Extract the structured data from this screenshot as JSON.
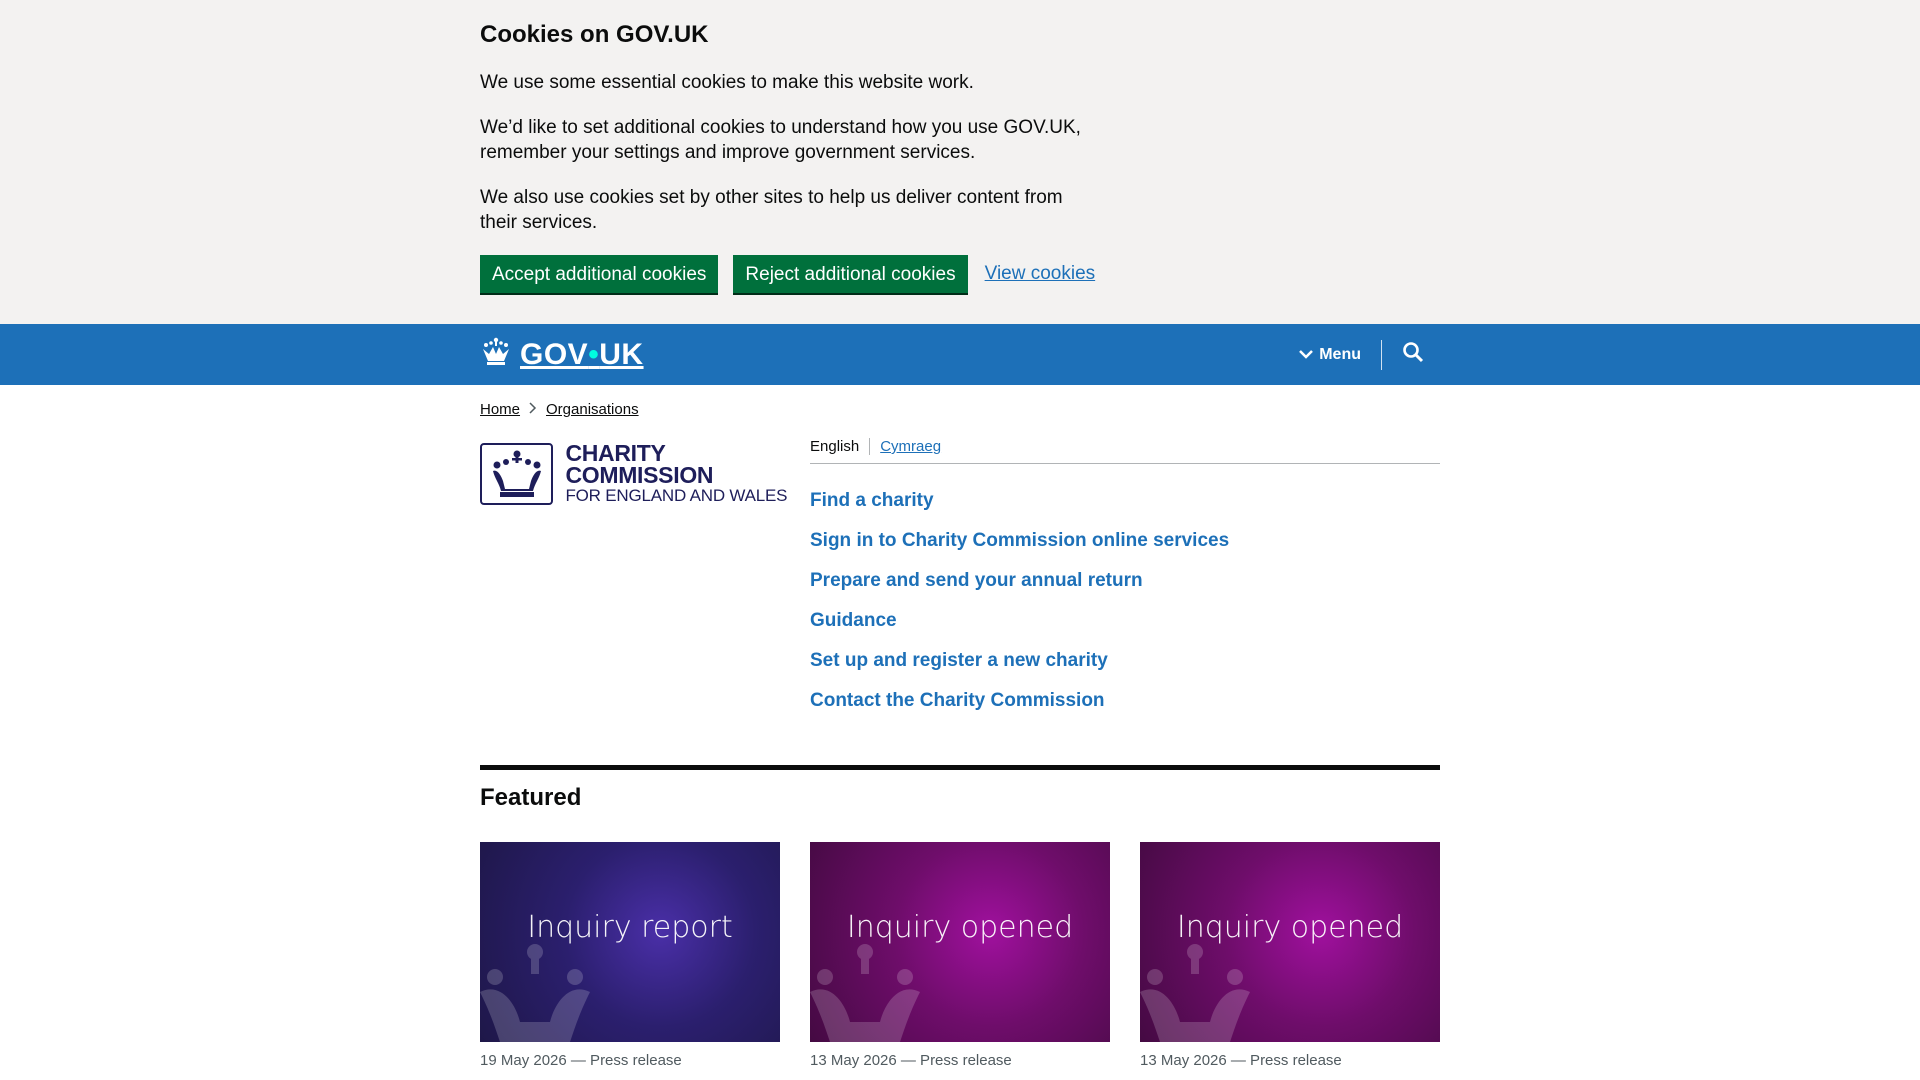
{
  "cookie_banner": {
    "title": "Cookies on GOV.UK",
    "p1": "We use some essential cookies to make this website work.",
    "p2": "We’d like to set additional cookies to understand how you use GOV.UK, remember your settings and improve government services.",
    "p3": "We also use cookies set by other sites to help us deliver content from their services.",
    "accept_label": "Accept additional cookies",
    "reject_label": "Reject additional cookies",
    "view_label": "View cookies"
  },
  "header": {
    "logo_text_left": "GOV",
    "logo_dot": "•",
    "logo_text_right": "UK",
    "menu_label": "Menu"
  },
  "breadcrumb": [
    {
      "label": "Home"
    },
    {
      "label": "Organisations"
    }
  ],
  "organisation": {
    "name_line1": "CHARITY COMMISSION",
    "name_line2": "FOR ENGLAND AND WALES"
  },
  "language": {
    "current": "English",
    "alternate": "Cymraeg"
  },
  "quick_links": [
    "Find a charity",
    "Sign in to Charity Commission online services",
    "Prepare and send your annual return",
    "Guidance",
    "Set up and register a new charity",
    "Contact the Charity Commission"
  ],
  "featured": {
    "title": "Featured",
    "cards": [
      {
        "image_label": "Inquiry report",
        "meta": "19 May 2026 — Press release",
        "color": "#2b1f6e"
      },
      {
        "image_label": "Inquiry opened",
        "meta": "13 May 2026 — Press release",
        "color": "#6e0d6a"
      },
      {
        "image_label": "Inquiry opened",
        "meta": "13 May 2026 — Press release",
        "color": "#6e0d6a"
      }
    ]
  },
  "colors": {
    "brand_blue": "#1d70b8",
    "button_green": "#00703c",
    "commission_navy": "#1e1e5a"
  }
}
